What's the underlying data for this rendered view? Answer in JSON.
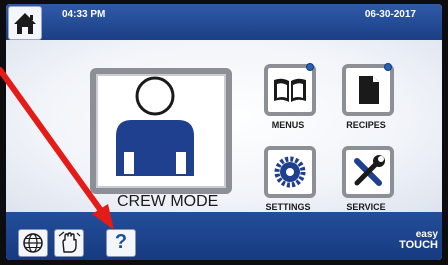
{
  "header": {
    "time": "04:33 PM",
    "date": "06-30-2017"
  },
  "main": {
    "crew_mode_label": "CREW MODE",
    "tiles": [
      {
        "label": "MENUS",
        "icon": "book-icon"
      },
      {
        "label": "RECIPES",
        "icon": "document-icon"
      },
      {
        "label": "SETTINGS",
        "icon": "gear-icon"
      },
      {
        "label": "SERVICE",
        "icon": "tools-icon"
      }
    ]
  },
  "footer": {
    "help_symbol": "?",
    "brand_line1": "easy",
    "brand_line2": "TOUCH",
    "buttons": [
      "globe-icon",
      "hand-icon",
      "help-icon"
    ]
  },
  "colors": {
    "bar_blue": "#1c3f86",
    "icon_blue": "#1c4fa0",
    "tile_border": "#8c8f96",
    "annotation_red": "#e41b17"
  }
}
